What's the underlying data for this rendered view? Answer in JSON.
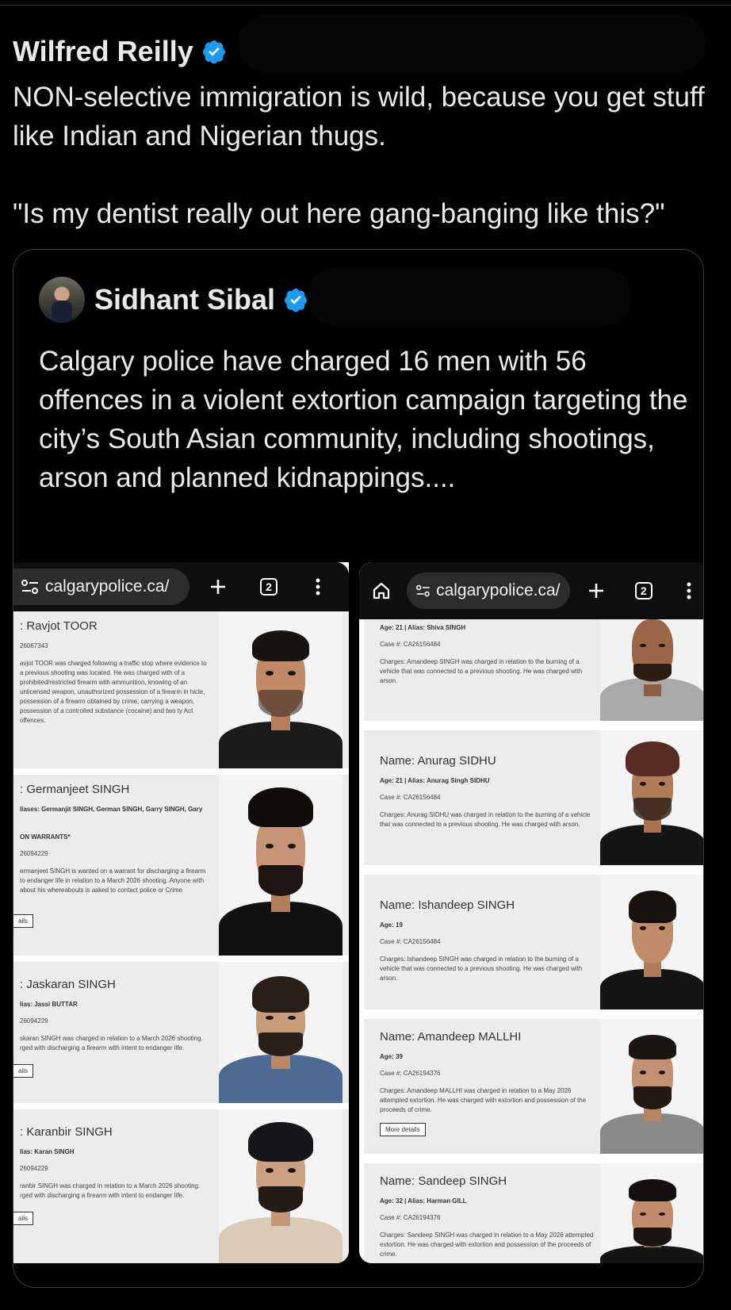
{
  "tweet": {
    "author_name": "Wilfred Reilly",
    "text_line1": "NON-selective immigration is wild, because you get stuff like Indian and Nigerian thugs.",
    "text_line2": "\"Is my dentist really out here gang-banging like this?\""
  },
  "quote": {
    "author_name": "Sidhant Sibal",
    "text": "Calgary police have charged 16 men with 56 offences in a violent extortion campaign targeting the city’s South Asian community, including shootings, arson and planned kidnappings...."
  },
  "colors": {
    "verified": "#1d9bf0",
    "background": "#000000",
    "text": "#e7e9ea"
  },
  "left_phone": {
    "url": "calgarypolice.ca/",
    "tab_count": "2",
    "cards": [
      {
        "name": ": Ravjot TOOR",
        "line": "",
        "case": "26067343",
        "desc": "avjot TOOR was charged following a traffic stop where evidence to a previous shooting was located. He was charged with of a prohibited/restricted firearm with ammunition, knowing of an unlicensed weapon, unauthorized possession of a firearm in hicle, possession of a firearm obtained by crime, carrying a weapon, possession of a controlled substance (cocaine) and two ty Act offences.",
        "button": ""
      },
      {
        "name": ": Germanjeet SINGH",
        "line": "liases: Germanjit SINGH, German SINGH, Garry SINGH, Gary",
        "warrant": "ON WARRANTS*",
        "case": "26094229",
        "desc": "ermanjeet SINGH is wanted on a warrant for discharging a firearm to endanger life in relation to a March 2026 shooting. Anyone with about his whereabouts is asked to contact police or Crime",
        "button": "ails"
      },
      {
        "name": ": Jaskaran SINGH",
        "line": "lias: Jassi BUTTAR",
        "case": "26094229",
        "desc": "skaran SINGH was charged in relation to a March 2026 shooting. rged with discharging a firearm with intent to endanger life.",
        "button": "ails"
      },
      {
        "name": ": Karanbir SINGH",
        "line": "lias: Karan SINGH",
        "case": "26094229",
        "desc": "ranbir SINGH was charged in relation to a March 2026 shooting. rged with discharging a firearm with intent to endanger life.",
        "button": "ails"
      }
    ]
  },
  "right_phone": {
    "url": "calgarypolice.ca/",
    "tab_count": "2",
    "cards": [
      {
        "name": "",
        "line": "Age: 21 | Alias: Shiva SINGH",
        "case": "Case #: CA26156484",
        "desc": "Charges: Amandeep SINGH was charged in relation to the burning of a vehicle that was connected to a previous shooting. He was charged with arson.",
        "button": ""
      },
      {
        "name": "Name: Anurag SIDHU",
        "line": "Age: 21 | Alias: Anurag Singh SIDHU",
        "case": "Case #: CA26156484",
        "desc": "Charges: Anurag SIDHU was charged in relation to the burning of a vehicle that was connected to a previous shooting. He was charged with arson.",
        "button": ""
      },
      {
        "name": "Name: Ishandeep SINGH",
        "line": "Age: 19",
        "case": "Case #: CA26156484",
        "desc": "Charges: Ishandeep SINGH was charged in relation to the burning of a vehicle that was connected to a previous shooting. He was charged with arson.",
        "button": ""
      },
      {
        "name": "Name: Amandeep MALLHI",
        "line": "Age: 39",
        "case": "Case #: CA26194376",
        "desc": "Charges: Amandeep MALLHI was charged in relation to a May 2026 attempted extortion. He was charged with extortion and possession of the proceeds of crime.",
        "button": "More details"
      },
      {
        "name": "Name: Sandeep SINGH",
        "line": "Age: 32 | Alias: Harman GILL",
        "case": "Case #: CA26194376",
        "desc": "Charges: Sandeep SINGH was charged in relation to a May 2026 attempted extortion. He was charged with extortion and possession of the proceeds of crime.",
        "button": ""
      }
    ]
  }
}
